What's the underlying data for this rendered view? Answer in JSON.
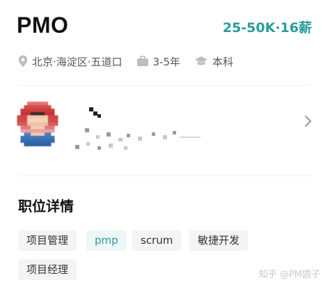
{
  "colors": {
    "accent": "#2c9c99",
    "text_primary": "#111111",
    "text_secondary": "#555555",
    "tag_background": "#f3f4f6"
  },
  "job": {
    "title": "PMO",
    "salary": "25-50K·16薪"
  },
  "meta": {
    "location": {
      "icon": "location-pin-icon",
      "text": "北京·海淀区·五道口"
    },
    "experience": {
      "icon": "briefcase-icon",
      "text": "3-5年"
    },
    "education": {
      "icon": "graduation-cap-icon",
      "text": "本科"
    }
  },
  "recruiter": {
    "avatar": "avatar-pixelated",
    "name": "",
    "title": "",
    "chevron": "chevron-right-icon"
  },
  "details": {
    "section_title": "职位详情",
    "tags": [
      "项目管理",
      "pmp",
      "scrum",
      "敏捷开发",
      "项目经理"
    ],
    "highlighted_tag_index": 1
  },
  "watermark": "知乎 @PM圆子"
}
